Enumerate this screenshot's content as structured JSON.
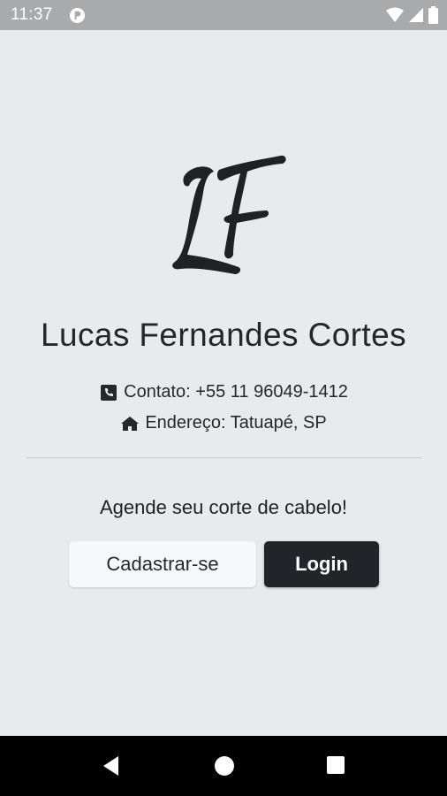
{
  "status_bar": {
    "time": "11:37",
    "icons": [
      "app-notification-icon",
      "wifi-icon",
      "signal-icon",
      "battery-icon"
    ]
  },
  "logo": {
    "monogram": "LF"
  },
  "profile": {
    "name": "Lucas Fernandes Cortes",
    "contact": "Contato: +55 11 96049-1412",
    "address": "Endereço: Tatuapé, SP"
  },
  "cta": {
    "tagline": "Agende seu corte de cabelo!",
    "register_label": "Cadastrar-se",
    "login_label": "Login"
  },
  "nav": {
    "icons": [
      "back-icon",
      "home-icon",
      "recents-icon"
    ]
  },
  "colors": {
    "background": "#e9eaed",
    "status_bar": "#a9aaab",
    "dark_button": "#212529",
    "light_button": "#f7f8fa",
    "text": "#25282b"
  }
}
